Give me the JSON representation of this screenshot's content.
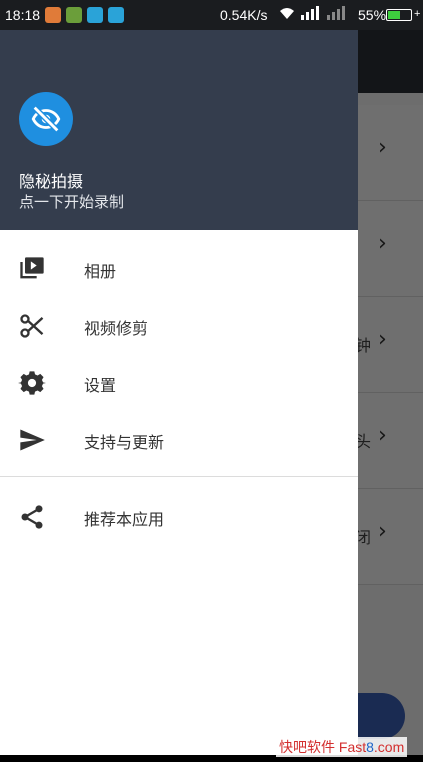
{
  "status_bar": {
    "time": "18:18",
    "net_speed": "0.54K/s",
    "battery_percent": "55%",
    "battery_level": 0.55,
    "colors": {
      "battery_fill": "#3ecf3e"
    }
  },
  "background_list": {
    "rows": [
      {
        "text": "",
        "chevron": "›"
      },
      {
        "text": "",
        "chevron": "›"
      },
      {
        "text": "钟",
        "chevron": "›"
      },
      {
        "text": "头",
        "chevron": "›"
      },
      {
        "text": "闭",
        "chevron": "›"
      }
    ]
  },
  "drawer": {
    "header": {
      "title": "隐秘拍摄",
      "subtitle": "点一下开始录制",
      "avatar_icon": "eye-off-icon"
    },
    "items": [
      {
        "label": "相册",
        "icon": "video-library-icon"
      },
      {
        "label": "视频修剪",
        "icon": "scissors-icon"
      },
      {
        "label": "设置",
        "icon": "gear-icon"
      },
      {
        "label": "支持与更新",
        "icon": "send-icon"
      },
      {
        "label": "推荐本应用",
        "icon": "share-icon"
      }
    ]
  },
  "watermark": {
    "prefix": "快吧软件 Fast",
    "num": "8",
    "suffix": ".com"
  }
}
